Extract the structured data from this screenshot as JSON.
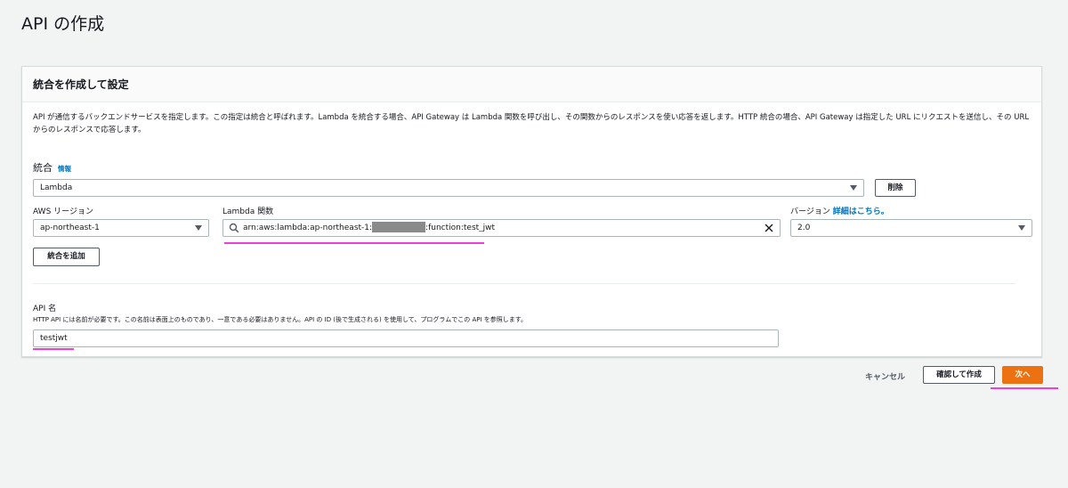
{
  "page": {
    "title": "API の作成"
  },
  "panel": {
    "title": "統合を作成して設定",
    "description": "API が通信するバックエンドサービスを指定します。この指定は統合と呼ばれます。Lambda を統合する場合、API Gateway は Lambda 関数を呼び出し、その関数からのレスポンスを使い応答を返します。HTTP 統合の場合、API Gateway は指定した URL にリクエストを送信し、その URL からのレスポンスで応答します。"
  },
  "integration": {
    "label": "統合",
    "info": "情報",
    "type_value": "Lambda",
    "delete_label": "削除",
    "region_label": "AWS リージョン",
    "region_value": "ap-northeast-1",
    "lambda_label": "Lambda 関数",
    "lambda_prefix": "arn:aws:lambda:ap-northeast-1:",
    "lambda_suffix": ":function:test_jwt",
    "version_label": "バージョン",
    "version_link": "詳細はこちら。",
    "version_value": "2.0",
    "add_label": "統合を追加"
  },
  "api_name": {
    "label": "API 名",
    "help": "HTTP API には名前が必要です。この名前は表面上のものであり、一意である必要はありません。API の ID (後で生成される) を使用して、プログラムでこの API を参照します。",
    "value": "testjwt"
  },
  "footer": {
    "cancel_label": "キャンセル",
    "review_label": "確認して作成",
    "next_label": "次へ"
  },
  "colors": {
    "accent": "#ec7211",
    "link": "#0073bb",
    "highlight": "#ef3fd8"
  }
}
